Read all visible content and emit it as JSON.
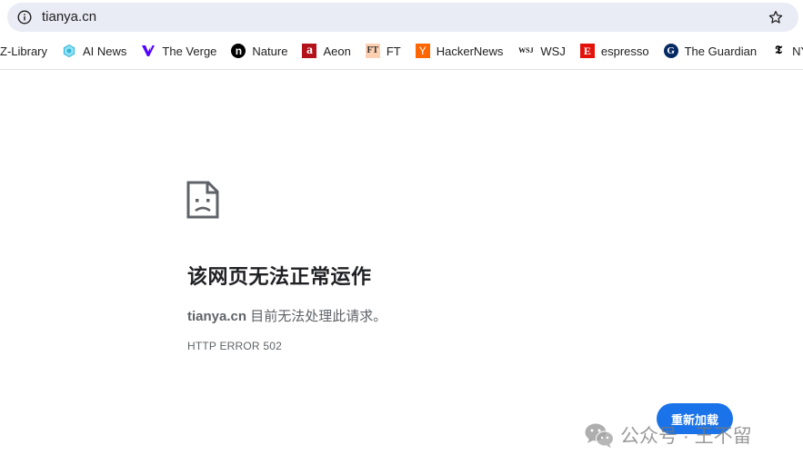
{
  "omnibox": {
    "url": "tianya.cn",
    "info_icon": "info-icon",
    "bookmark_icon": "star-icon"
  },
  "bookmarks": [
    {
      "label": "Z-Library",
      "icon": "none"
    },
    {
      "label": "AI News",
      "icon": "gear-badge-icon",
      "color": "#2bb3d9"
    },
    {
      "label": "The Verge",
      "icon": "verge-logo-icon",
      "color": "#5200ff"
    },
    {
      "label": "Nature",
      "icon": "nature-logo-icon",
      "color": "#000000"
    },
    {
      "label": "Aeon",
      "icon": "aeon-logo-icon",
      "color": "#b3121b"
    },
    {
      "label": "FT",
      "icon": "ft-logo-icon",
      "color": "#fcd0b1"
    },
    {
      "label": "HackerNews",
      "icon": "hn-logo-icon",
      "color": "#ff6600"
    },
    {
      "label": "WSJ",
      "icon": "wsj-logo-icon",
      "color": "#111111"
    },
    {
      "label": "espresso",
      "icon": "espresso-logo-icon",
      "color": "#e3120b"
    },
    {
      "label": "The Guardian",
      "icon": "guardian-logo-icon",
      "color": "#052962"
    },
    {
      "label": "NYTim",
      "icon": "nyt-logo-icon",
      "color": "#000000"
    }
  ],
  "icon_text": {
    "nature": "n",
    "aeon": "a",
    "ft": "FT",
    "hn": "Y",
    "wsj": "WSJ",
    "espresso": "E",
    "guardian": "G",
    "nyt": "𝕿"
  },
  "error": {
    "title": "该网页无法正常运作",
    "host": "tianya.cn",
    "message": " 目前无法处理此请求。",
    "code": "HTTP ERROR 502",
    "reload_label": "重新加载"
  },
  "watermark": {
    "text": "公众号 · 王不留"
  },
  "colors": {
    "accent": "#1a73e8",
    "omnibox_bg": "#e9ebf5"
  }
}
